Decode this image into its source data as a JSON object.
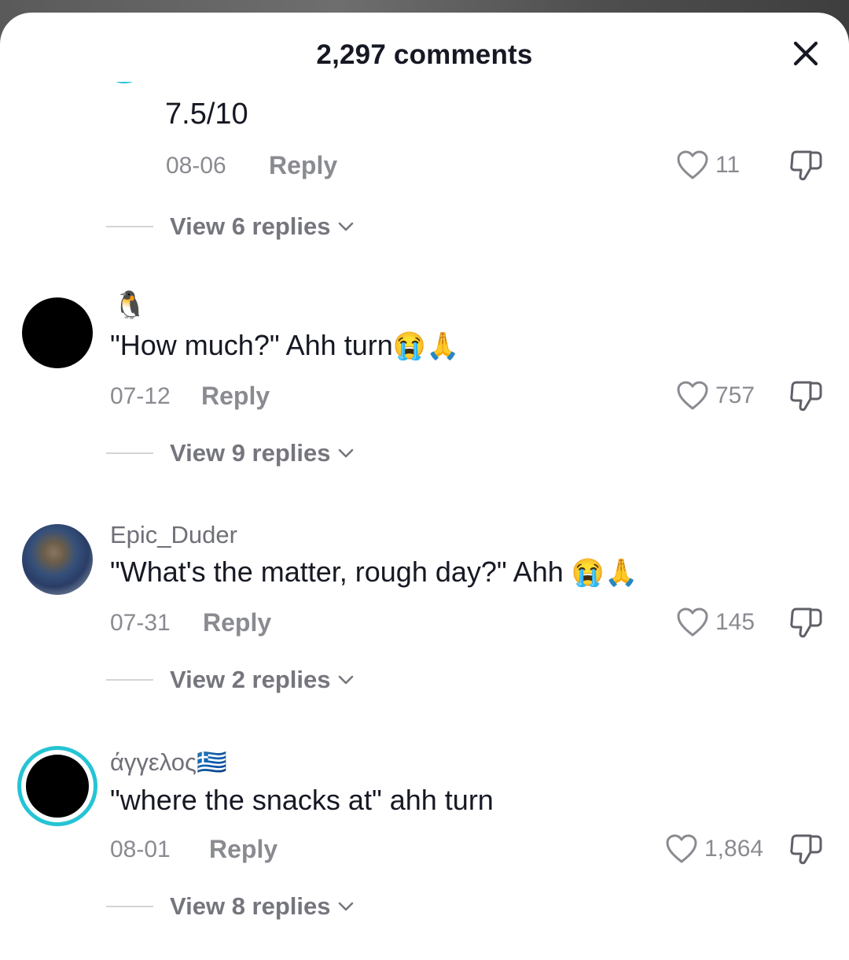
{
  "header": {
    "title": "2,297 comments",
    "close_label": "✕"
  },
  "comments": [
    {
      "username": "",
      "text": "7.5/10",
      "date": "08-06",
      "reply_label": "Reply",
      "likes": "11",
      "view_replies": "View 6 replies"
    },
    {
      "username": "🐧",
      "text": "\"How much?\" Ahh turn",
      "emoji": "😭🙏",
      "date": "07-12",
      "reply_label": "Reply",
      "likes": "757",
      "view_replies": "View 9 replies"
    },
    {
      "username": "Epic_Duder",
      "text": "\"What's the matter, rough day?\" Ahh",
      "emoji": "😭🙏",
      "date": "07-31",
      "reply_label": "Reply",
      "likes": "145",
      "view_replies": "View 2 replies"
    },
    {
      "username": "άγγελος🇬🇷",
      "text": "\"where the snacks at\" ahh turn",
      "date": "08-01",
      "reply_label": "Reply",
      "likes": "1,864",
      "view_replies": "View 8 replies"
    }
  ],
  "colors": {
    "text_primary": "#161823",
    "text_secondary": "#8a8b91",
    "story_ring": "#25c4d4"
  },
  "icons": [
    "close-icon",
    "heart-icon",
    "dislike-icon",
    "chevron-down-icon"
  ]
}
